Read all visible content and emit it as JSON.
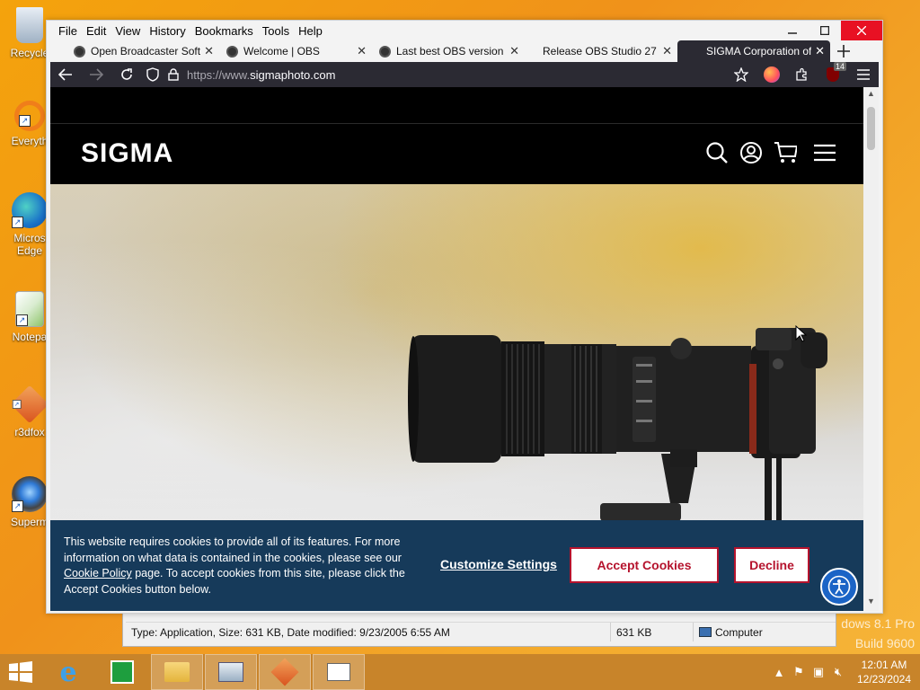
{
  "desktop": {
    "icons": [
      {
        "label": "Recycle"
      },
      {
        "label": "Everyth"
      },
      {
        "label": "Micros Edge"
      },
      {
        "label": "Notepa"
      },
      {
        "label": "r3dfox"
      },
      {
        "label": "Superm"
      }
    ],
    "watermark_line1": "dows 8.1 Pro",
    "watermark_line2": "Build 9600"
  },
  "browser": {
    "menu": [
      "File",
      "Edit",
      "View",
      "History",
      "Bookmarks",
      "Tools",
      "Help"
    ],
    "tabs": [
      {
        "title": "Open Broadcaster Softw"
      },
      {
        "title": "Welcome | OBS"
      },
      {
        "title": "Last best OBS version ·"
      },
      {
        "title": "Release OBS Studio 27"
      },
      {
        "title": "SIGMA Corporation of"
      }
    ],
    "url_scheme": "https://www.",
    "url_host": "sigmaphoto.com",
    "extension_badge": "14"
  },
  "site": {
    "logo": "SIGMA"
  },
  "cookie_banner": {
    "text_part1": "This website requires cookies to provide all of its features. For more information on what data is contained in the cookies, please see our ",
    "policy_link": "Cookie Policy",
    "text_part2": " page. To accept cookies from this site, please click the Accept Cookies button below.",
    "customize": "Customize Settings",
    "accept": "Accept Cookies",
    "decline": "Decline"
  },
  "explorer_status": {
    "details": "Type: Application, Size: 631 KB, Date modified: 9/23/2005 6:55 AM",
    "size": "631 KB",
    "location": "Computer"
  },
  "taskbar": {
    "time": "12:01 AM",
    "date": "12/23/2024"
  },
  "colors": {
    "accent_red": "#b5132d",
    "banner_navy": "#163a5a",
    "browser_dark": "#2b2a33"
  }
}
